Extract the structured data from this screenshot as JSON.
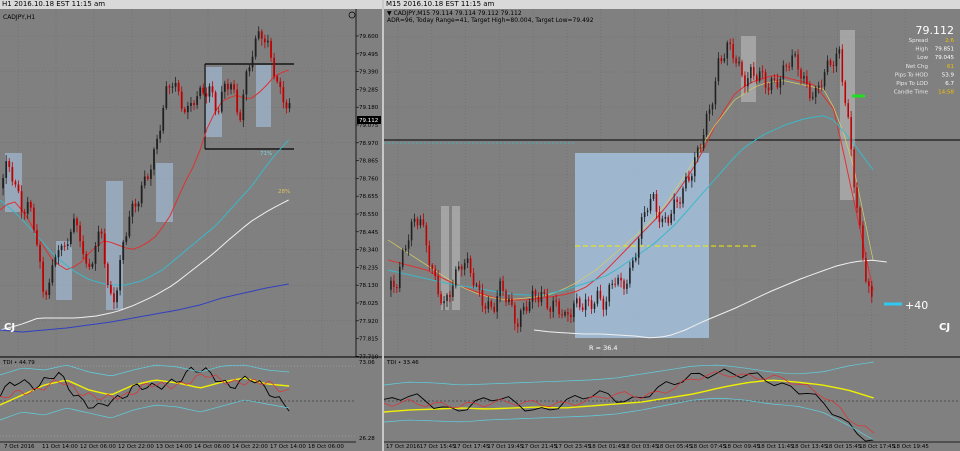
{
  "left_window": {
    "title": "H1 2016.10.18 EST 11:15 am",
    "symbol": "CADJPY,H1",
    "logo": "CJ",
    "indicator_label": "TDI • 44.79",
    "price_labels": [
      "79.600",
      "79.495",
      "79.390",
      "79.285",
      "79.180",
      "79.075",
      "78.970",
      "78.865",
      "78.760",
      "78.655",
      "78.550",
      "78.445",
      "78.340",
      "78.235",
      "78.130",
      "78.025",
      "77.920",
      "77.815",
      "77.710"
    ],
    "current_price": "79.112",
    "indicator_scale": [
      "73.06",
      "26.28"
    ],
    "time_labels": [
      "7 Oct 2016",
      "11 Oct 14:00",
      "12 Oct 06:00",
      "12 Oct 22:00",
      "13 Oct 14:00",
      "14 Oct 06:00",
      "14 Oct 22:00",
      "17 Oct 14:00",
      "18 Oct 06:00"
    ],
    "zone_labels": [
      "71%",
      "28%"
    ]
  },
  "right_window": {
    "title": "M15 2016.10.18 EST 11:15 am",
    "symbol_line": "▼ CADJPY,M15  79.114 79.114 79.112 79.112",
    "info_line": "ADR=96, Today Range=41, Target High=80.004, Target Low=79.492",
    "logo": "CJ",
    "range_label": "R = 36.4",
    "pips_label": "+40",
    "indicator_label": "TDI • 33.46",
    "time_labels": [
      "17 Oct 2016",
      "17 Oct 15:45",
      "17 Oct 17:45",
      "17 Oct 19:45",
      "17 Oct 21:45",
      "17 Oct 23:45",
      "18 Oct 01:45",
      "18 Oct 03:45",
      "18 Oct 05:45",
      "18 Oct 07:45",
      "18 Oct 09:45",
      "18 Oct 11:45",
      "18 Oct 13:45",
      "18 Oct 15:45",
      "18 Oct 17:45",
      "18 Oct 19:45"
    ],
    "panel": {
      "price": "79.112",
      "rows": [
        {
          "label": "Spread",
          "value": "2.6",
          "color": "#f0c000"
        },
        {
          "label": "High",
          "value": "79.851",
          "color": "#ffffff"
        },
        {
          "label": "Low",
          "value": "79.045",
          "color": "#ffffff"
        },
        {
          "label": "Net Chg",
          "value": "61",
          "color": "#f0c000"
        },
        {
          "label": "Pips To HOD",
          "value": "53.9",
          "color": "#ffffff"
        },
        {
          "label": "Pips To LOD",
          "value": "6.7",
          "color": "#ffffff"
        },
        {
          "label": "Candle Time",
          "value": "14:58",
          "color": "#f0c000"
        }
      ]
    }
  },
  "colors": {
    "chart_bg": "#808080",
    "bull_candle": "#202020",
    "bear_candle": "#c00000",
    "ma_red": "#e03030",
    "ma_cyan": "#3ab8c8",
    "ma_white": "#f0f0f0",
    "ma_blue": "#3040c0",
    "tdi_yellow": "#f0f000",
    "zone_blue": "#a8c8e8"
  }
}
